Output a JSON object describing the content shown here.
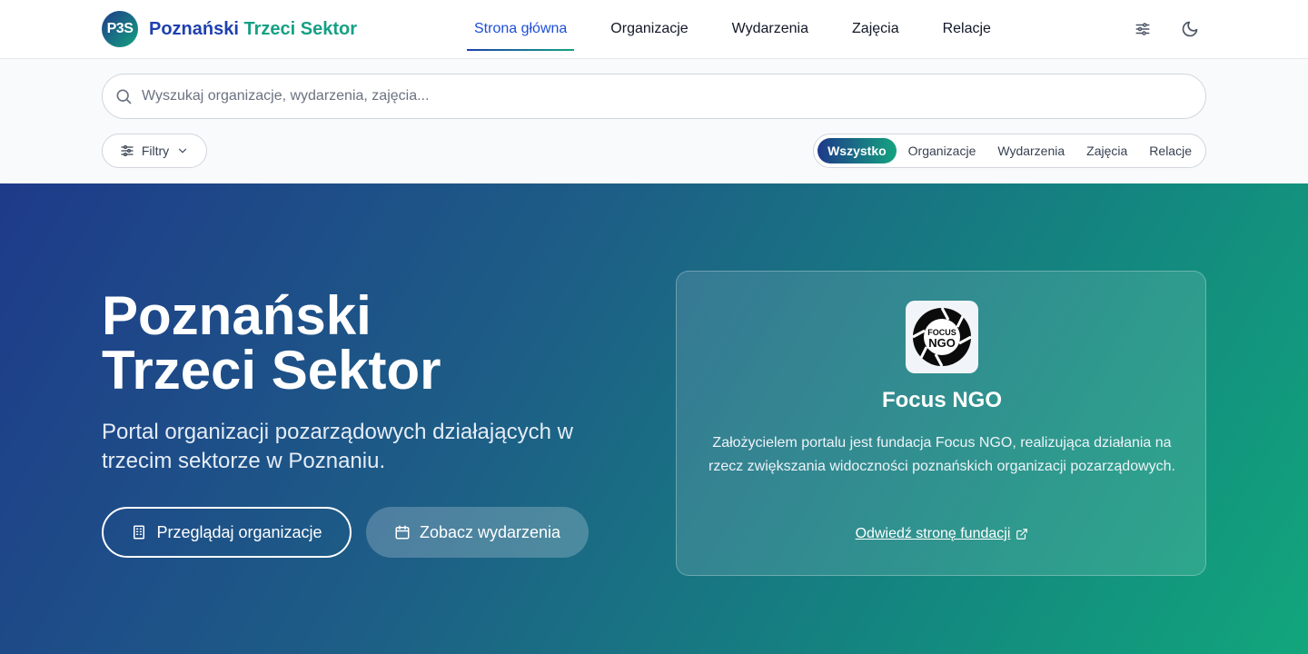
{
  "header": {
    "logo_text": "P3S",
    "brand_part1": "Poznański ",
    "brand_part2": "Trzeci Sektor",
    "nav": [
      {
        "label": "Strona główna"
      },
      {
        "label": "Organizacje"
      },
      {
        "label": "Wydarzenia"
      },
      {
        "label": "Zajęcia"
      },
      {
        "label": "Relacje"
      }
    ],
    "active_nav": "Strona główna",
    "icons": [
      "sliders-icon",
      "moon-icon"
    ]
  },
  "search": {
    "placeholder": "Wyszukaj organizacje, wydarzenia, zajęcia...",
    "value": "",
    "filter_label": "Filtry",
    "segments": [
      {
        "label": "Wszystko"
      },
      {
        "label": "Organizacje"
      },
      {
        "label": "Wydarzenia"
      },
      {
        "label": "Zajęcia"
      },
      {
        "label": "Relacje"
      }
    ],
    "active_segment": "Wszystko"
  },
  "hero": {
    "title_line1": "Poznański",
    "title_line2": "Trzeci Sektor",
    "subtitle": "Portal organizacji pozarządowych działających w trzecim sektorze w Poznaniu.",
    "primary_button": "Przeglądaj organizacje",
    "secondary_button": "Zobacz wydarzenia"
  },
  "card": {
    "logo_text_line1": "FOCUS",
    "logo_text_line2": "NGO",
    "title": "Focus NGO",
    "text": "Założycielem portalu jest fundacja Focus NGO, realizująca działania na rzecz zwiększania widoczności poznańskich organizacji pozarządowych.",
    "link": "Odwiedź stronę fundacji"
  },
  "colors": {
    "primary": "#1e40af",
    "accent": "#16a085",
    "hero_start": "#1e3a8a",
    "hero_end": "#12a67c"
  }
}
